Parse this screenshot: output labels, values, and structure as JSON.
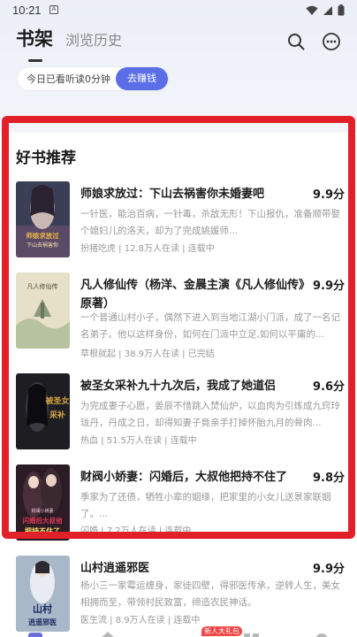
{
  "status": {
    "time": "10:21",
    "badge": "A"
  },
  "header": {
    "tab_active": "书架",
    "tab_inactive": "浏览历史"
  },
  "reading": {
    "text": "今日已看听读0分钟",
    "button": "去赚钱"
  },
  "section": {
    "title": "好书推荐"
  },
  "books": [
    {
      "title": "师娘求放过：下山去祸害你未婚妻吧",
      "score": "9.9分",
      "desc": "一针医，能治百病，一针毒，杀敌无形！下山报仇，准备顺带娶个媳妇儿的洛天，却为了完成姚媛师...",
      "author": "扮猪吃虎",
      "readers": "12.8万人在读",
      "status": "连载中"
    },
    {
      "title": "凡人修仙传（杨洋、金晨主演《凡人修仙传》原著）",
      "score": "9.9分",
      "desc": "一个普通山村小子，偶然下进入到当地江湖小门派，成了一名记名弟子。他以这样身份，如何在门派中立足,如何以平庸的...",
      "author": "草根就起",
      "readers": "38.9万人在读",
      "status": "已完结"
    },
    {
      "title": "被圣女采补九十九次后，我成了她道侣",
      "score": "9.6分",
      "desc": "为完成妻子心愿，姜辰不惜跳入焚仙炉，以血肉为引炼成九窍玲珑丹，丹成之日，却得知妻子竟亲手打掉怀胎九月的骨肉...",
      "author": "热血",
      "readers": "51.5万人在读",
      "status": "连载中"
    },
    {
      "title": "财阀小娇妻：闪婚后，大叔他把持不住了",
      "score": "9.8分",
      "desc": "季家为了还债，牺牲小辈的姻缘，把家里的小女儿送景家联姻了。...",
      "author": "闪婚",
      "readers": "7.2万人在读",
      "status": "连载中"
    },
    {
      "title": "山村逍遥邪医",
      "score": "9.9分",
      "desc": "杨小三一家霉运缠身，家徒四壁，得邪医传承，逆转人生，美女相拥而至，带领村民致富，缔造农民神话。",
      "author": "医生流",
      "readers": "8.9万人在读",
      "status": "连载中"
    }
  ],
  "covers": [
    {
      "text1": "师娘求放过",
      "text2": "下山去祸害你",
      "bg": "#3b3f55",
      "accent": "#e8b34a"
    },
    {
      "text1": "凡人修仙传",
      "bg": "#d9d3b7",
      "accent": "#7a8f6a"
    },
    {
      "text1": "被圣女",
      "text2": "采补",
      "bg": "#1d1d22",
      "accent": "#d9a640"
    },
    {
      "text1": "闪婚后大叔他",
      "text2": "把持不住了",
      "top": "财阀小娇妻",
      "bg": "#2a1b24",
      "accent": "#e03a5a"
    },
    {
      "text1": "山村",
      "text2": "逍遥邪医",
      "bg": "#7b8ca3",
      "accent": "#1d2a63"
    }
  ],
  "bottom_nav": {
    "badge": "新人大礼包"
  },
  "colors": {
    "accent": "#5b6ee8",
    "highlight": "#e1202a"
  }
}
